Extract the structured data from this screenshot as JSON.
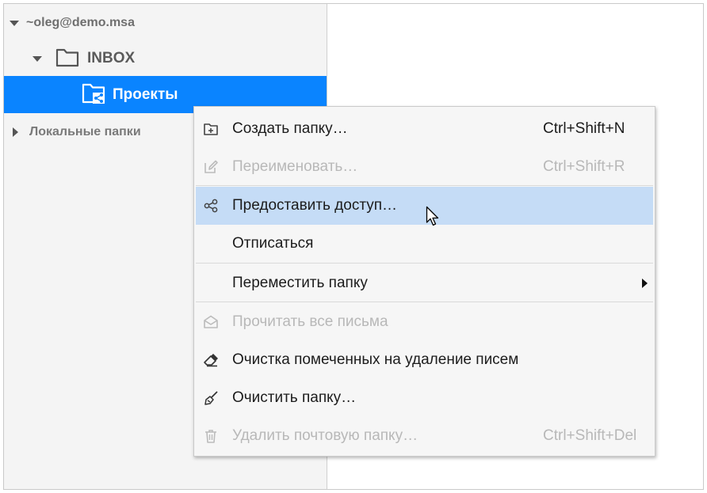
{
  "folder_tree": {
    "account": {
      "label": "~oleg@demo.msa"
    },
    "inbox": {
      "label": "INBOX",
      "icon": "folder-icon"
    },
    "projects": {
      "label": "Проекты",
      "icon": "shared-folder-icon",
      "selected": true
    },
    "local_folders": {
      "label": "Локальные папки"
    }
  },
  "context_menu": {
    "items": [
      {
        "label": "Создать папку…",
        "shortcut": "Ctrl+Shift+N",
        "icon": "new-folder-icon",
        "enabled": true
      },
      {
        "label": "Переименовать…",
        "shortcut": "Ctrl+Shift+R",
        "icon": "rename-icon",
        "enabled": false
      },
      {
        "label": "Предоставить доступ…",
        "shortcut": "",
        "icon": "share-icon",
        "enabled": true,
        "highlighted": true
      },
      {
        "label": "Отписаться",
        "shortcut": "",
        "icon": "",
        "enabled": true
      },
      {
        "label": "Переместить папку",
        "shortcut": "",
        "icon": "",
        "enabled": true,
        "has_submenu": true
      },
      {
        "label": "Прочитать все письма",
        "shortcut": "",
        "icon": "open-envelope-icon",
        "enabled": false
      },
      {
        "label": "Очистка помеченных на удаление писем",
        "shortcut": "",
        "icon": "eraser-icon",
        "enabled": true
      },
      {
        "label": "Очистить папку…",
        "shortcut": "",
        "icon": "broom-icon",
        "enabled": true
      },
      {
        "label": "Удалить почтовую папку…",
        "shortcut": "Ctrl+Shift+Del",
        "icon": "trash-icon",
        "enabled": false
      }
    ]
  },
  "colors": {
    "selection": "#0a84ff",
    "menu_highlight": "#c5dcf6",
    "sidebar_bg": "#f4f4f4",
    "disabled_text": "#b8b8b8"
  }
}
